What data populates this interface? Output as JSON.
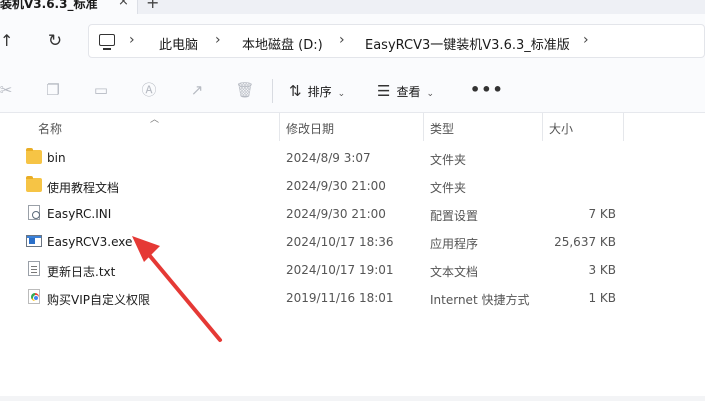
{
  "tab": {
    "title": "装机V3.6.3_标准",
    "close": "×",
    "new": "+"
  },
  "address": {
    "breadcrumbs": [
      "此电脑",
      "本地磁盘 (D:)",
      "EasyRCV3一键装机V3.6.3_标准版"
    ],
    "separator": "›"
  },
  "nav": {
    "up": "↑",
    "refresh": "↻"
  },
  "toolbar": {
    "icons": [
      "cut-icon",
      "copy-icon",
      "paste-icon",
      "rename-icon",
      "share-icon",
      "delete-icon"
    ],
    "sort_label": "排序",
    "view_label": "查看",
    "more_label": "•••"
  },
  "columns": {
    "name": "名称",
    "date": "修改日期",
    "type": "类型",
    "size": "大小"
  },
  "files": [
    {
      "name": "bin",
      "date": "2024/8/9 3:07",
      "type": "文件夹",
      "size": "",
      "icon": "folder-icon"
    },
    {
      "name": "使用教程文档",
      "date": "2024/9/30 21:00",
      "type": "文件夹",
      "size": "",
      "icon": "folder-icon"
    },
    {
      "name": "EasyRC.INI",
      "date": "2024/9/30 21:00",
      "type": "配置设置",
      "size": "7 KB",
      "icon": "ini-file-icon"
    },
    {
      "name": "EasyRCV3.exe",
      "date": "2024/10/17 18:36",
      "type": "应用程序",
      "size": "25,637 KB",
      "icon": "exe-file-icon"
    },
    {
      "name": "更新日志.txt",
      "date": "2024/10/17 19:01",
      "type": "文本文档",
      "size": "3 KB",
      "icon": "txt-file-icon"
    },
    {
      "name": "购买VIP自定义权限",
      "date": "2019/11/16 18:01",
      "type": "Internet 快捷方式",
      "size": "1 KB",
      "icon": "internet-shortcut-icon"
    }
  ],
  "colors": {
    "folder": "#f6c445",
    "annotation_arrow": "#e53935",
    "toolbar_bg": "#fafbfd"
  }
}
